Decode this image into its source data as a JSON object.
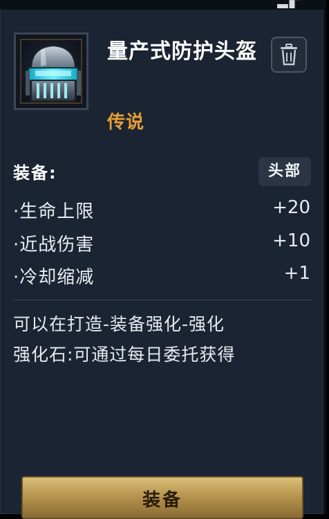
{
  "item": {
    "name": "量产式防护头盔",
    "rarity": "传说",
    "icon": "helmet-icon"
  },
  "equip_section": {
    "label": "装备:",
    "slot_badge": "头部"
  },
  "stats": [
    {
      "name": "·生命上限",
      "value": "+20"
    },
    {
      "name": "·近战伤害",
      "value": "+10"
    },
    {
      "name": "·冷却缩减",
      "value": "+1"
    }
  ],
  "description": {
    "line1": "可以在打造-装备强化-强化",
    "line2": "强化石:可通过每日委托获得"
  },
  "actions": {
    "equip_label": "装备",
    "delete_icon": "trash-icon"
  },
  "colors": {
    "rarity_legendary": "#e7a034",
    "panel_bg": "#1b2432",
    "button_gold": "#b8964f"
  }
}
